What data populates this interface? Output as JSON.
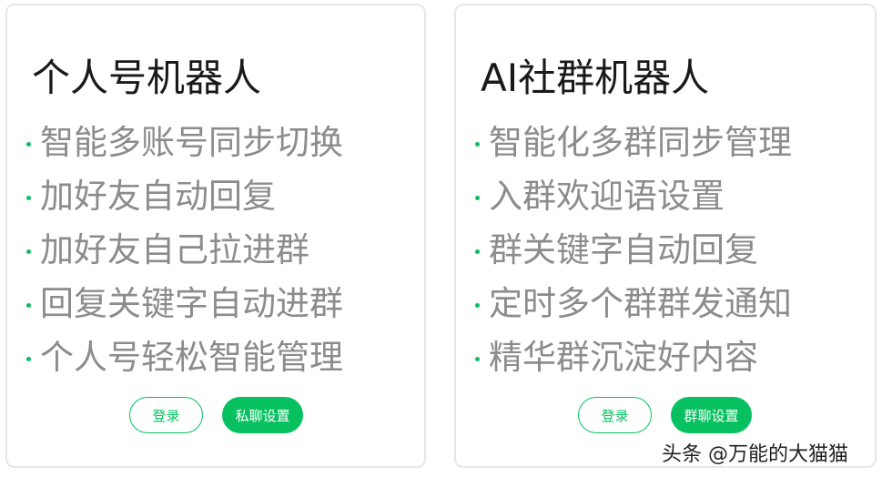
{
  "cards": [
    {
      "title": "个人号机器人",
      "features": [
        "智能多账号同步切换",
        "加好友自动回复",
        "加好友自己拉进群",
        "回复关键字自动进群",
        "个人号轻松智能管理"
      ],
      "buttons": {
        "login": "登录",
        "settings": "私聊设置"
      }
    },
    {
      "title": "AI社群机器人",
      "features": [
        "智能化多群同步管理",
        "入群欢迎语设置",
        "群关键字自动回复",
        "定时多个群群发通知",
        "精华群沉淀好内容"
      ],
      "buttons": {
        "login": "登录",
        "settings": "群聊设置"
      }
    }
  ],
  "watermark": "头条 @万能的大猫猫",
  "colors": {
    "accent": "#07c160",
    "feature_text": "#8c8c8c",
    "title_text": "#1a1a1a",
    "border": "#e6e6e6"
  }
}
